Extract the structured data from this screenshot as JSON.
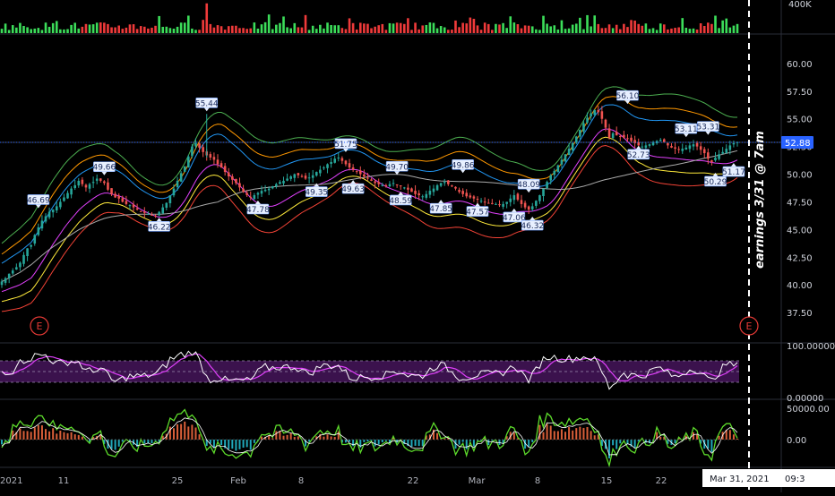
{
  "chart_data": {
    "type": "candlestick",
    "price_axis": {
      "min": 35.0,
      "max": 62.5,
      "tick_labels": [
        "60.00",
        "57.50",
        "55.00",
        "52.50",
        "50.00",
        "47.50",
        "45.00",
        "42.50",
        "40.00",
        "37.50"
      ],
      "tick_values": [
        60,
        57.5,
        55,
        52.5,
        50,
        47.5,
        45,
        42.5,
        40,
        37.5
      ]
    },
    "last_price": {
      "label": "52.88",
      "value": 52.88,
      "color": "#2962ff"
    },
    "volume_axis": {
      "label": "400K",
      "max": 400000
    },
    "rsi_axis": {
      "top_label": "100.00000",
      "bottom_label": "0.00000"
    },
    "osc_axis": {
      "top_label": "50000.00",
      "mid_label": "0.00"
    },
    "x_axis": {
      "tick_labels": [
        "2021",
        "11",
        "25",
        "Feb",
        "8",
        "22",
        "Mar",
        "8",
        "15",
        "22"
      ],
      "cursor_label": "Mar 31, 2021",
      "cursor_time": "09:3"
    },
    "annotation": "earnings 3/31 @ 7am",
    "earnings_markers": [
      "E",
      "E"
    ],
    "callouts": [
      {
        "label": "46.69",
        "date_index": 10,
        "value": 46.69,
        "side": "high"
      },
      {
        "label": "49.66",
        "date_index": 28,
        "value": 49.66,
        "side": "high"
      },
      {
        "label": "46.22",
        "date_index": 43,
        "value": 46.22,
        "side": "low"
      },
      {
        "label": "55.44",
        "date_index": 56,
        "value": 55.44,
        "side": "high"
      },
      {
        "label": "47.78",
        "date_index": 70,
        "value": 47.78,
        "side": "low"
      },
      {
        "label": "49.35",
        "date_index": 86,
        "value": 49.35,
        "side": "low"
      },
      {
        "label": "51.75",
        "date_index": 94,
        "value": 51.75,
        "side": "high"
      },
      {
        "label": "49.63",
        "date_index": 96,
        "value": 49.63,
        "side": "low"
      },
      {
        "label": "49.70",
        "date_index": 108,
        "value": 49.7,
        "side": "high"
      },
      {
        "label": "48.59",
        "date_index": 109,
        "value": 48.59,
        "side": "low"
      },
      {
        "label": "47.85",
        "date_index": 120,
        "value": 47.85,
        "side": "low"
      },
      {
        "label": "49.86",
        "date_index": 126,
        "value": 49.86,
        "side": "high"
      },
      {
        "label": "47.57",
        "date_index": 130,
        "value": 47.57,
        "side": "low"
      },
      {
        "label": "47.06",
        "date_index": 140,
        "value": 47.06,
        "side": "low"
      },
      {
        "label": "48.09",
        "date_index": 144,
        "value": 48.09,
        "side": "high"
      },
      {
        "label": "46.32",
        "date_index": 145,
        "value": 46.32,
        "side": "low"
      },
      {
        "label": "56.10",
        "date_index": 171,
        "value": 56.1,
        "side": "high"
      },
      {
        "label": "52.73",
        "date_index": 174,
        "value": 52.73,
        "side": "low"
      },
      {
        "label": "53.11",
        "date_index": 187,
        "value": 53.11,
        "side": "high"
      },
      {
        "label": "53.31",
        "date_index": 193,
        "value": 53.31,
        "side": "high"
      },
      {
        "label": "50.29",
        "date_index": 195,
        "value": 50.29,
        "side": "low"
      },
      {
        "label": "51.17",
        "date_index": 200,
        "value": 51.17,
        "side": "low"
      }
    ],
    "closes": [
      40.3,
      40.6,
      41.0,
      41.3,
      41.6,
      42.0,
      42.7,
      43.3,
      43.6,
      44.5,
      45.2,
      45.8,
      46.2,
      46.6,
      46.8,
      47.1,
      47.5,
      47.9,
      48.3,
      48.7,
      49.0,
      49.4,
      49.1,
      48.8,
      49.1,
      49.3,
      49.6,
      49.4,
      49.2,
      48.6,
      48.2,
      47.9,
      47.8,
      47.5,
      47.3,
      47.2,
      47.0,
      46.8,
      46.6,
      46.5,
      46.4,
      46.3,
      46.2,
      46.6,
      47.0,
      47.4,
      48.1,
      48.7,
      49.4,
      50.1,
      50.7,
      51.6,
      52.5,
      52.8,
      52.4,
      52.0,
      51.7,
      51.5,
      51.3,
      50.9,
      50.6,
      50.2,
      49.8,
      49.5,
      49.2,
      48.8,
      48.4,
      48.1,
      47.9,
      48.1,
      48.3,
      48.5,
      48.6,
      48.7,
      48.9,
      49.1,
      49.3,
      49.4,
      49.6,
      49.8,
      50.0,
      49.9,
      49.8,
      49.6,
      49.7,
      49.9,
      50.2,
      50.4,
      50.6,
      50.9,
      51.1,
      51.4,
      51.5,
      51.2,
      50.9,
      50.6,
      50.4,
      50.2,
      50.0,
      49.8,
      49.6,
      49.4,
      49.2,
      49.1,
      49.0,
      48.9,
      49.1,
      49.2,
      49.0,
      48.9,
      48.8,
      48.6,
      48.4,
      48.2,
      48.1,
      48.0,
      48.2,
      48.5,
      48.7,
      49.0,
      49.2,
      49.3,
      49.1,
      48.9,
      48.7,
      48.4,
      48.2,
      48.0,
      47.9,
      47.8,
      47.7,
      47.6,
      47.5,
      47.4,
      47.3,
      47.3,
      47.2,
      47.3,
      47.5,
      47.8,
      48.1,
      47.7,
      47.3,
      47.0,
      46.8,
      47.1,
      47.6,
      48.1,
      48.7,
      49.3,
      49.9,
      50.3,
      50.8,
      51.3,
      51.8,
      52.3,
      52.8,
      53.4,
      54.0,
      54.6,
      55.1,
      55.5,
      55.8,
      55.6,
      55.0,
      54.2,
      53.3,
      53.7,
      53.5,
      53.4,
      53.3,
      53.2,
      53.0,
      52.8,
      52.6,
      52.5,
      52.6,
      52.7,
      52.9,
      53.0,
      53.1,
      52.9,
      52.6,
      52.4,
      52.3,
      52.2,
      52.3,
      52.4,
      52.6,
      52.7,
      52.5,
      52.2,
      51.9,
      51.4,
      51.1,
      51.5,
      51.8,
      52.0,
      52.3,
      52.6,
      52.8,
      52.9
    ],
    "series": [
      {
        "name": "",
        "color": "#4caf50",
        "role": "bb-upper-3"
      },
      {
        "name": "",
        "color": "#ff9800",
        "role": "bb-upper-2"
      },
      {
        "name": "",
        "color": "#2196f3",
        "role": "bb-upper-1"
      },
      {
        "name": "",
        "color": "#e040fb",
        "role": "bb-lower-1"
      },
      {
        "name": "",
        "color": "#ffeb3b",
        "role": "bb-lower-2"
      },
      {
        "name": "",
        "color": "#f44336",
        "role": "bb-lower-3"
      },
      {
        "name": "",
        "color": "#aaaaaa",
        "role": "long-ma"
      }
    ],
    "colors": {
      "up": "#26a69a",
      "down": "#ef5350",
      "volume_up": "#3cdd5a",
      "volume_down": "#ef3a3a",
      "rsi_band": "#4a1660",
      "rsi_line": "#ffffff",
      "rsi_signal": "#e040fb",
      "osc_line": "#5ddb2b",
      "osc_hist_up": "#ff7043",
      "osc_hist_down": "#26c6da",
      "earnings_marker": "#e53935"
    }
  }
}
